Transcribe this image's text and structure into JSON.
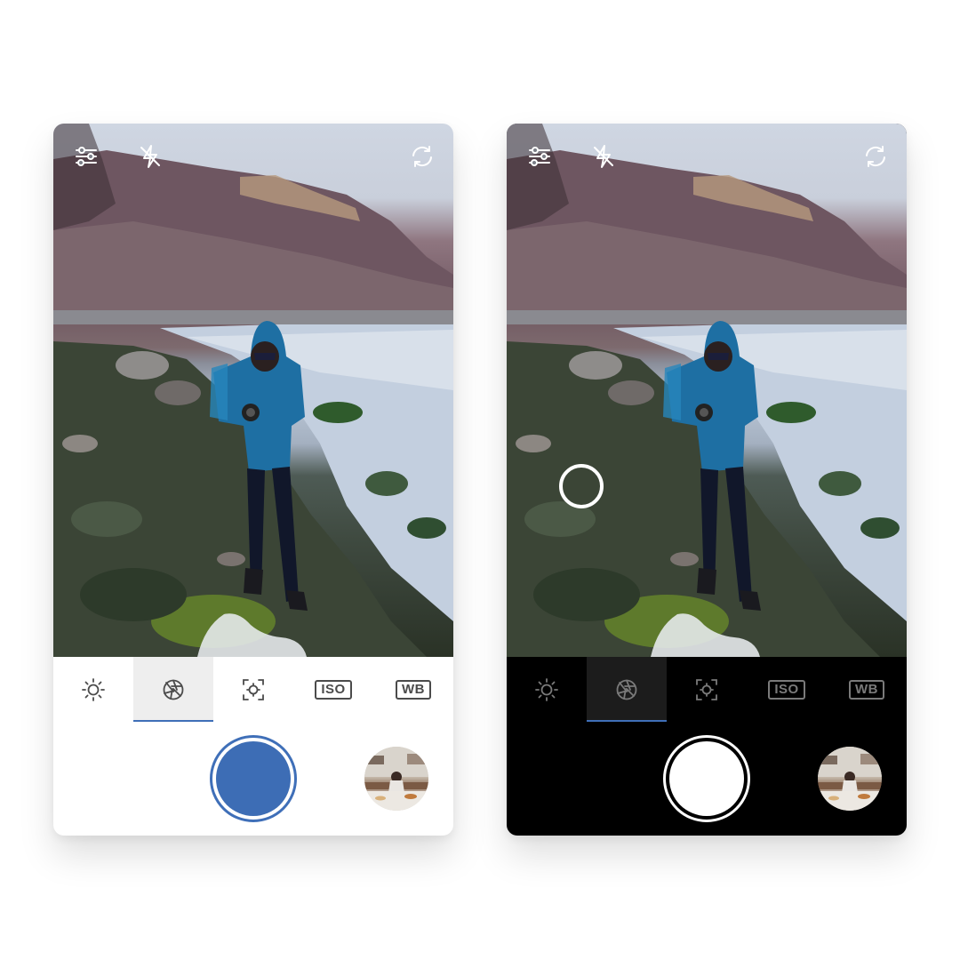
{
  "colors": {
    "accent": "#3f6fb8",
    "shutter_light": "#3d6db5",
    "shutter_dark": "#ffffff",
    "dark_bg": "#000000",
    "light_bg": "#ffffff"
  },
  "phones": [
    {
      "theme": "light",
      "top_bar": [
        "sliders-icon",
        "flash-off-icon",
        "switch-camera-icon"
      ],
      "focus_ring_visible": false,
      "tools": [
        {
          "icon": "brightness-icon",
          "label": "",
          "active": false
        },
        {
          "icon": "aperture-icon",
          "label": "",
          "active": true
        },
        {
          "icon": "focus-icon",
          "label": "",
          "active": false
        },
        {
          "icon": "iso-icon",
          "label": "ISO",
          "active": false
        },
        {
          "icon": "white-balance-icon",
          "label": "WB",
          "active": false
        }
      ]
    },
    {
      "theme": "dark",
      "top_bar": [
        "sliders-icon",
        "flash-off-icon",
        "switch-camera-icon"
      ],
      "focus_ring_visible": true,
      "tools": [
        {
          "icon": "brightness-icon",
          "label": "",
          "active": false
        },
        {
          "icon": "aperture-icon",
          "label": "",
          "active": true
        },
        {
          "icon": "focus-icon",
          "label": "",
          "active": false
        },
        {
          "icon": "iso-icon",
          "label": "ISO",
          "active": false
        },
        {
          "icon": "white-balance-icon",
          "label": "WB",
          "active": false
        }
      ]
    }
  ]
}
